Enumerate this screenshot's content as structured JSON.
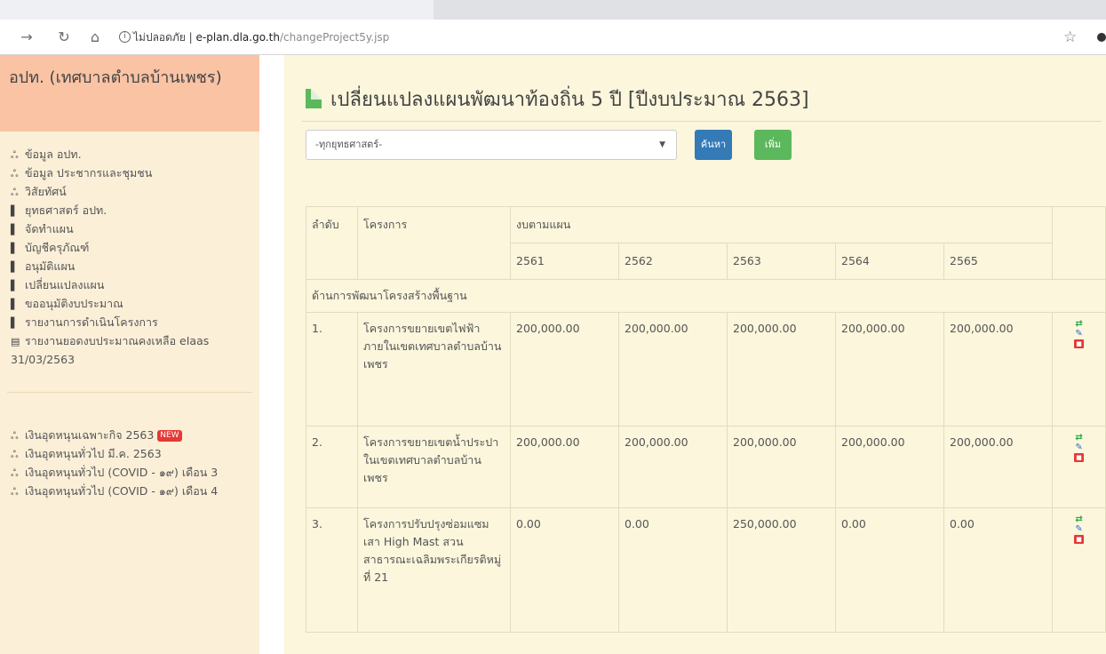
{
  "browser": {
    "url_secure_label": "ไม่ปลอดภัย",
    "url_host": "e-plan.dla.go.th",
    "url_path": "/changeProject5y.jsp",
    "back_icon": "arrow-right-icon",
    "reload_icon": "reload-icon",
    "home_icon": "home-icon",
    "star_icon": "star-icon"
  },
  "sidebar": {
    "header": "อปท. (เทศบาลตำบลบ้านเพชร)",
    "menu": [
      {
        "icon": "sitemap-icon",
        "label": "ข้อมูล อปท."
      },
      {
        "icon": "sitemap-icon",
        "label": "ข้อมูล ประชากรและชุมชน"
      },
      {
        "icon": "sitemap-icon",
        "label": "วิสัยทัศน์"
      },
      {
        "icon": "bookmark-icon",
        "label": "ยุทธศาสตร์ อปท."
      },
      {
        "icon": "bookmark-icon",
        "label": "จัดทำแผน"
      },
      {
        "icon": "bookmark-icon",
        "label": "บัญชีครุภัณฑ์"
      },
      {
        "icon": "bookmark-icon",
        "label": "อนุมัติแผน"
      },
      {
        "icon": "bookmark-icon",
        "label": "เปลี่ยนแปลงแผน"
      },
      {
        "icon": "bookmark-icon",
        "label": "ขออนุมัติงบประมาณ"
      },
      {
        "icon": "bookmark-icon",
        "label": "รายงานการดำเนินโครงการ"
      },
      {
        "icon": "file-icon",
        "label": "รายงานยอดงบประมาณคงเหลือ eIaas 31/03/2563"
      }
    ],
    "menu2": [
      {
        "icon": "sitemap-icon",
        "label": "เงินอุดหนุนเฉพาะกิจ 2563",
        "badge": "NEW"
      },
      {
        "icon": "sitemap-icon",
        "label": "เงินอุดหนุนทั่วไป มี.ค. 2563"
      },
      {
        "icon": "sitemap-icon",
        "label": "เงินอุดหนุนทั่วไป (COVID - ๑๙) เดือน 3"
      },
      {
        "icon": "sitemap-icon",
        "label": "เงินอุดหนุนทั่วไป (COVID - ๑๙) เดือน 4"
      }
    ]
  },
  "main": {
    "title": "เปลี่ยนแปลงแผนพัฒนาท้องถิ่น 5 ปี [ปีงบประมาณ 2563]",
    "strategy_select": "-ทุกยุทธศาสตร์-",
    "search_label": "ค้นหา",
    "add_label": "เพิ่ม",
    "table": {
      "col_no": "ลำดับ",
      "col_project": "โครงการ",
      "col_budget": "งบตามแผน",
      "years": [
        "2561",
        "2562",
        "2563",
        "2564",
        "2565"
      ],
      "section": "ด้านการพัฒนาโครงสร้างพื้นฐาน",
      "rows": [
        {
          "no": "1.",
          "project": "โครงการขยายเขตไฟฟ้าภายในเขตเทศบาลตำบลบ้านเพชร",
          "values": [
            "200,000.00",
            "200,000.00",
            "200,000.00",
            "200,000.00",
            "200,000.00"
          ]
        },
        {
          "no": "2.",
          "project": "โครงการขยายเขตน้ำประปาในเขตเทศบาลตำบลบ้านเพชร",
          "values": [
            "200,000.00",
            "200,000.00",
            "200,000.00",
            "200,000.00",
            "200,000.00"
          ]
        },
        {
          "no": "3.",
          "project": "โครงการปรับปรุงซ่อมแซมเสา High Mast สวนสาธารณะเฉลิมพระเกียรติหมู่ที่ 21",
          "values": [
            "0.00",
            "0.00",
            "250,000.00",
            "0.00",
            "0.00"
          ]
        }
      ],
      "action_icons": [
        "transfer-icon",
        "edit-icon",
        "delete-icon"
      ]
    }
  }
}
